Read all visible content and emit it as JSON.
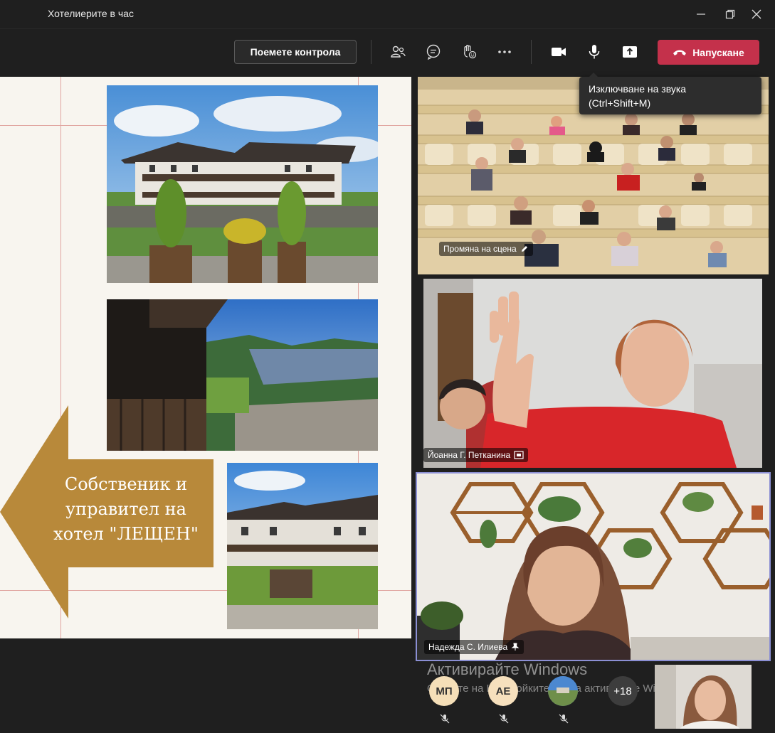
{
  "window": {
    "title": "Хотелиерите в час"
  },
  "toolbar": {
    "take_control_label": "Поемете контрола",
    "leave_label": "Напускане"
  },
  "tooltip": {
    "line1": "Изключване на звука",
    "line2": "(Ctrl+Shift+M)"
  },
  "slide": {
    "arrow_text_line1": "Собственик и",
    "arrow_text_line2": "управител на",
    "arrow_text_line3": "хотел \"ЛЕЩЕН\"",
    "accent_color": "#b8893a"
  },
  "participants": {
    "tile1_label": "Промяна на сцена",
    "tile2_label": "Йоанна Г. Петканина",
    "tile3_label": "Надежда С. Илиева",
    "highlight_color": "#8b8fd4"
  },
  "strip": {
    "avatar1": "МП",
    "avatar2": "АЕ",
    "more_count": "+18"
  },
  "watermark": {
    "line1": "Активирайте Windows",
    "line2": "Отидете на Настройките, за да активирате Windows."
  }
}
